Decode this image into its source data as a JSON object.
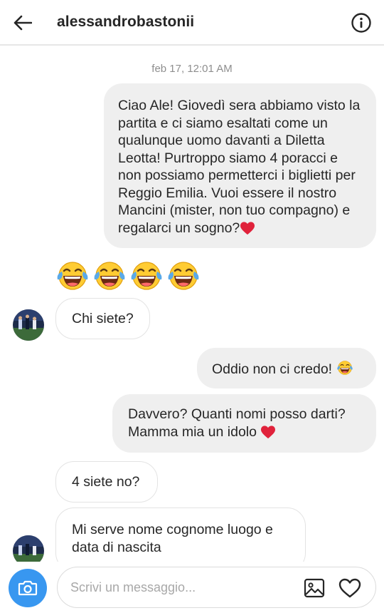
{
  "header": {
    "back_icon": "arrow-left-icon",
    "username": "alessandrobastonii",
    "info_icon": "info-circle-icon"
  },
  "timestamp": "feb 17, 12:01 AM",
  "messages": [
    {
      "side": "sent",
      "text": "Ciao Ale! Giovedì sera abbiamo visto la partita e ci siamo esaltati come un qualunque uomo davanti a Diletta Leotta! Purtroppo siamo 4 poracci e non possiamo permetterci i biglietti per Reggio Emilia. Vuoi essere il nostro Mancini (mister, non tuo compagno) e regalarci un sogno?",
      "trailing_icon": "red-heart-icon"
    },
    {
      "side": "received",
      "emojis": [
        "tears-of-joy-icon",
        "tears-of-joy-icon",
        "tears-of-joy-icon",
        "tears-of-joy-icon"
      ]
    },
    {
      "side": "received",
      "text": "Chi siete?"
    },
    {
      "side": "sent",
      "text": "Oddio non ci credo!",
      "trailing_icon": "tears-of-joy-icon"
    },
    {
      "side": "sent",
      "text": "Davvero? Quanti nomi posso darti?",
      "text2": "Mamma mia un idolo",
      "trailing_icon": "red-heart-icon"
    },
    {
      "side": "received",
      "text": "4 siete no?"
    },
    {
      "side": "received",
      "text": "Mi serve nome cognome luogo e data di nascita"
    }
  ],
  "composer": {
    "camera_icon": "camera-icon",
    "placeholder": "Scrivi un messaggio...",
    "gallery_icon": "image-icon",
    "like_icon": "heart-outline-icon"
  },
  "colors": {
    "camera_button": "#3897f0",
    "sent_bubble": "#efefef",
    "received_border": "#e3e3e3",
    "heart": "#e0223b",
    "emoji_face": "#ffcc33",
    "emoji_tears": "#5aa9e8"
  }
}
